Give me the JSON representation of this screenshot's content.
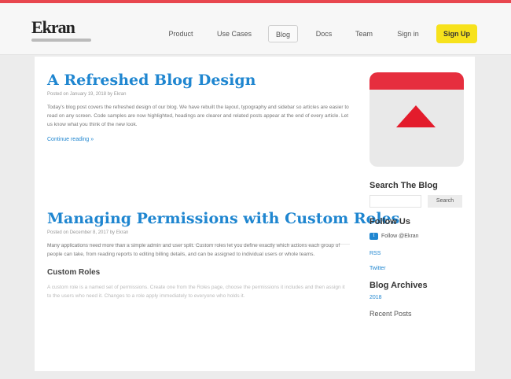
{
  "header": {
    "logo_text": "Ekran",
    "nav": [
      "Product",
      "Use Cases",
      "Blog",
      "Docs",
      "Team",
      "Sign in"
    ],
    "cta_label": "Sign Up"
  },
  "posts": [
    {
      "title": "A Refreshed Blog Design",
      "meta": "Posted on January 19, 2018 by Ekran",
      "body": "Today's blog post covers the refreshed design of our blog. We have rebuilt the layout, typography and sidebar so articles are easier to read on any screen. Code samples are now highlighted, headings are clearer and related posts appear at the end of every article. Let us know what you think of the new look.",
      "read_more": "Continue reading »"
    },
    {
      "title": "Managing Permissions with Custom Roles",
      "meta": "Posted on December 8, 2017 by Ekran",
      "body": "Many applications need more than a simple admin and user split. Custom roles let you define exactly which actions each group of people can take, from reading reports to editing billing details, and can be assigned to individual users or whole teams.",
      "subhead": "Custom Roles",
      "body2": "A custom role is a named set of permissions. Create one from the Roles page, choose the permissions it includes and then assign it to the users who need it. Changes to a role apply immediately to everyone who holds it."
    }
  ],
  "sidebar": {
    "search_title": "Search The Blog",
    "search_placeholder": "",
    "search_button": "Search",
    "follow_title": "Follow Us",
    "follow_icon": "t",
    "follow_label": "Follow @Ekran",
    "links": [
      "RSS",
      "Twitter"
    ],
    "archives_title": "Blog Archives",
    "archive_link": "2018",
    "recent_title": "Recent Posts"
  },
  "colors": {
    "accent": "#1f86d0",
    "topbar": "#e8474f",
    "cta": "#f7e21c",
    "card_red": "#e62e3e"
  }
}
